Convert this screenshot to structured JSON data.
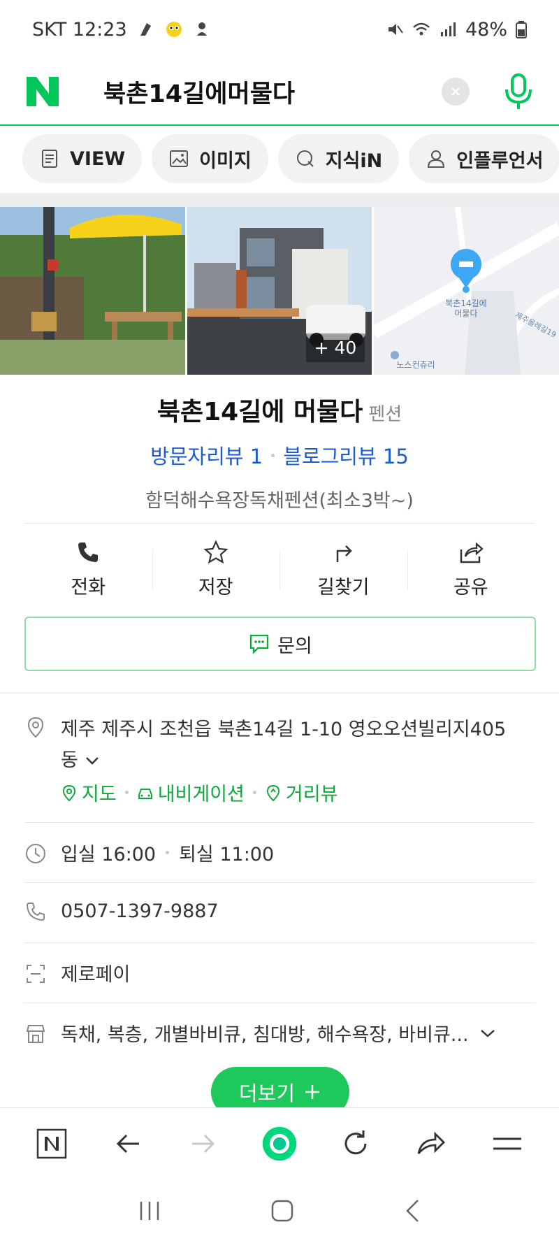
{
  "status_bar": {
    "carrier_time": "SKT 12:23",
    "battery": "48%"
  },
  "search": {
    "query": "북촌14길에머물다"
  },
  "chips": [
    {
      "label": "VIEW",
      "icon": "document-icon"
    },
    {
      "label": "이미지",
      "icon": "image-icon"
    },
    {
      "label": "지식iN",
      "icon": "q-icon"
    },
    {
      "label": "인플루언서",
      "icon": "person-icon"
    }
  ],
  "photos": {
    "count_label": "+ 40",
    "map_label": "북촌14길에\n머물다",
    "map_road": "제주올레길19",
    "map_poi": "노스컨츄리"
  },
  "place": {
    "name": "북촌14길에 머물다",
    "category": "펜션",
    "visitor_review": "방문자리뷰 1",
    "blog_review": "블로그리뷰 15",
    "description": "함덕해수욕장독채펜션(최소3박~)"
  },
  "actions": [
    {
      "label": "전화",
      "icon": "phone-icon"
    },
    {
      "label": "저장",
      "icon": "star-icon"
    },
    {
      "label": "길찾기",
      "icon": "directions-icon"
    },
    {
      "label": "공유",
      "icon": "share-icon"
    }
  ],
  "inquiry": {
    "label": "문의"
  },
  "info": {
    "address_line1": "제주 제주시 조천읍 북촌14길 1-10 영오오션빌리지405",
    "address_line2": "동",
    "link_map": "지도",
    "link_nav": "내비게이션",
    "link_street": "거리뷰",
    "checkin": "입실 16:00",
    "checkout": "퇴실 11:00",
    "phone": "0507-1397-9887",
    "pay": "제로페이",
    "amenities": "독채, 복층, 개별바비큐, 침대방, 해수욕장, 바비큐..."
  },
  "more_button": {
    "label": "더보기"
  },
  "colors": {
    "brand_green": "#03c75a",
    "link_blue": "#1a5ad3",
    "link_green": "#0ea83d"
  }
}
